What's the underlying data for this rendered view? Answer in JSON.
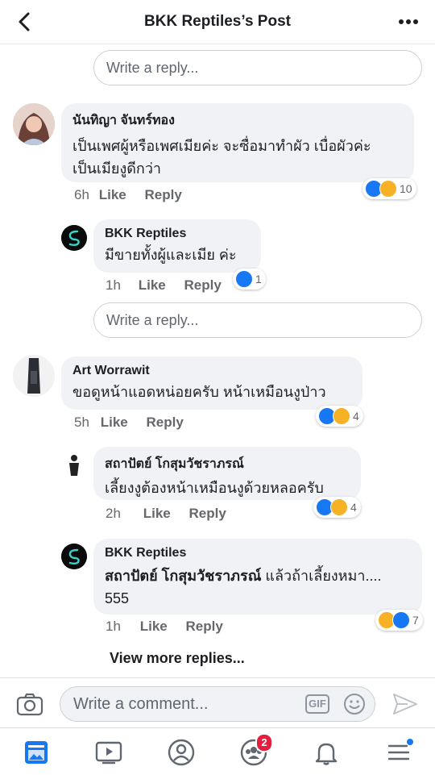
{
  "header": {
    "title": "BKK Reptiles’s Post"
  },
  "reply_placeholder": "Write a reply...",
  "comments": [
    {
      "name": "นันทิญา จันทร์ทอง",
      "lines": [
        "เป็นเพศผู้หรือเพศเมียค่ะ จะซื่อมาทำผัว เบื่อผัวค่ะ",
        "เป็นเมียงูดีกว่า"
      ],
      "time": "6h",
      "like": "Like",
      "reply": "Reply",
      "reactions": "10"
    },
    {
      "name": "BKK Reptiles",
      "lines": [
        "มีขายทั้งผู้และเมีย ค่ะ"
      ],
      "time": "1h",
      "like": "Like",
      "reply": "Reply",
      "reactions": "1"
    },
    {
      "name": "Art Worrawit",
      "lines": [
        "ขอดูหน้าแอดหน่อยครับ หน้าเหมือนงูป่าว"
      ],
      "time": "5h",
      "like": "Like",
      "reply": "Reply",
      "reactions": "4"
    },
    {
      "name": "สถาปัตย์ โกสุมวัชราภรณ์",
      "lines": [
        "เลี้ยงงูต้องหน้าเหมือนงูด้วยหลอครับ"
      ],
      "time": "2h",
      "like": "Like",
      "reply": "Reply",
      "reactions": "4"
    },
    {
      "name": "BKK Reptiles",
      "mention": "สถาปัตย์ โกสุมวัชราภรณ์",
      "text_after": " แล้วถ้าเลี้ยงหมา....",
      "line2": "555",
      "time": "1h",
      "like": "Like",
      "reply": "Reply",
      "reactions": "7"
    }
  ],
  "view_more": "View more replies...",
  "composer": {
    "placeholder": "Write a comment...",
    "gif": "GIF"
  },
  "tabbar": {
    "groups_badge": "2"
  },
  "colors": {
    "like_blue": "#1877f2",
    "haha_yellow": "#f7b125",
    "badge_red": "#e41e3f"
  }
}
